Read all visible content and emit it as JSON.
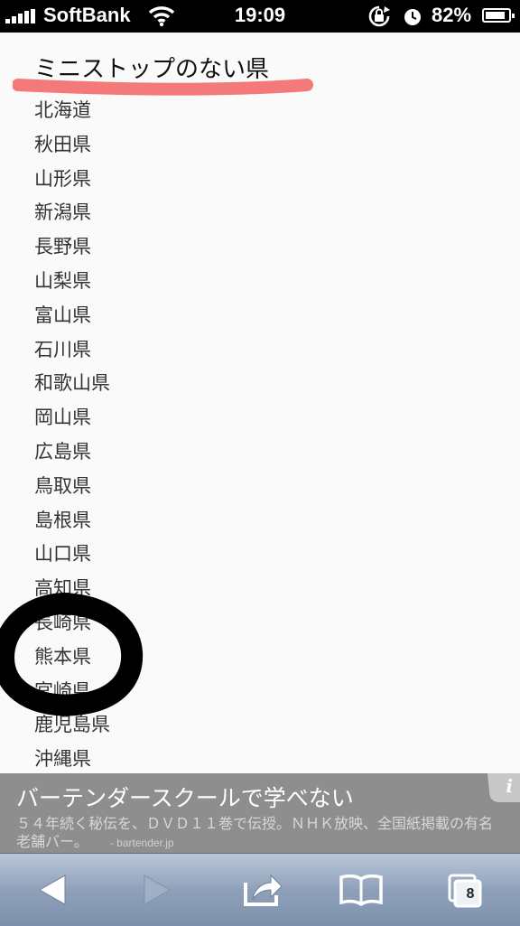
{
  "status_bar": {
    "carrier": "SoftBank",
    "time": "19:09",
    "battery_percent": "82%",
    "signal_bars": 5,
    "battery_level": 0.82
  },
  "page": {
    "heading": "ミニストップのない県",
    "prefectures": [
      "北海道",
      "秋田県",
      "山形県",
      "新潟県",
      "長野県",
      "山梨県",
      "富山県",
      "石川県",
      "和歌山県",
      "岡山県",
      "広島県",
      "鳥取県",
      "島根県",
      "山口県",
      "高知県",
      "長崎県",
      "熊本県",
      "宮崎県",
      "鹿児島県",
      "沖縄県"
    ],
    "highlight_colors": {
      "underline": "#f47a7a",
      "circle": "#000000"
    }
  },
  "ad": {
    "title": "バーテンダースクールで学べない",
    "body": "５４年続く秘伝を、ＤＶＤ１１巻で伝授。ＮＨＫ放映、全国紙掲載の有名老舗バー。",
    "source": "- bartender.jp",
    "info_label": "i"
  },
  "toolbar": {
    "tab_count": "8"
  }
}
